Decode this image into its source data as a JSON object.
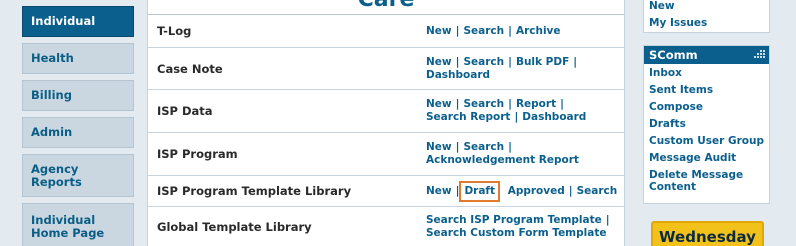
{
  "left_nav": {
    "items": [
      {
        "label": "Individual",
        "active": true
      },
      {
        "label": "Health",
        "active": false
      },
      {
        "label": "Billing",
        "active": false
      },
      {
        "label": "Admin",
        "active": false
      },
      {
        "label": "Agency Reports",
        "active": false
      },
      {
        "label": "Individual Home Page",
        "active": false
      }
    ]
  },
  "center": {
    "header": "Care",
    "rows": [
      {
        "label": "T-Log",
        "links": [
          "New",
          "Search",
          "Archive"
        ]
      },
      {
        "label": "Case Note",
        "links": [
          "New",
          "Search",
          "Bulk PDF",
          "Dashboard"
        ]
      },
      {
        "label": "ISP Data",
        "links": [
          "New",
          "Search",
          "Report",
          "Search Report",
          "Dashboard"
        ]
      },
      {
        "label": "ISP Program",
        "links": [
          "New",
          "Search",
          "Acknowledgement Report"
        ]
      },
      {
        "label": "ISP Program Template Library",
        "links": [
          "New",
          "Draft",
          "Approved",
          "Search"
        ],
        "highlighted": "Draft"
      },
      {
        "label": "Global Template Library",
        "links": [
          "Search ISP Program Template",
          "Search Custom Form Template"
        ]
      }
    ]
  },
  "right": {
    "top_links": [
      "New",
      "My Issues"
    ],
    "scomm": {
      "title": "SComm",
      "links": [
        "Inbox",
        "Sent Items",
        "Compose",
        "Drafts",
        "Custom User Group",
        "Message Audit",
        "Delete Message Content"
      ]
    },
    "date_badge": "Wednesday"
  },
  "colors": {
    "brand_blue": "#0b5f8c",
    "nav_inactive_bg": "#cad7e1",
    "highlight_outline": "#e07a2e",
    "badge_yellow": "#f2c21b"
  }
}
